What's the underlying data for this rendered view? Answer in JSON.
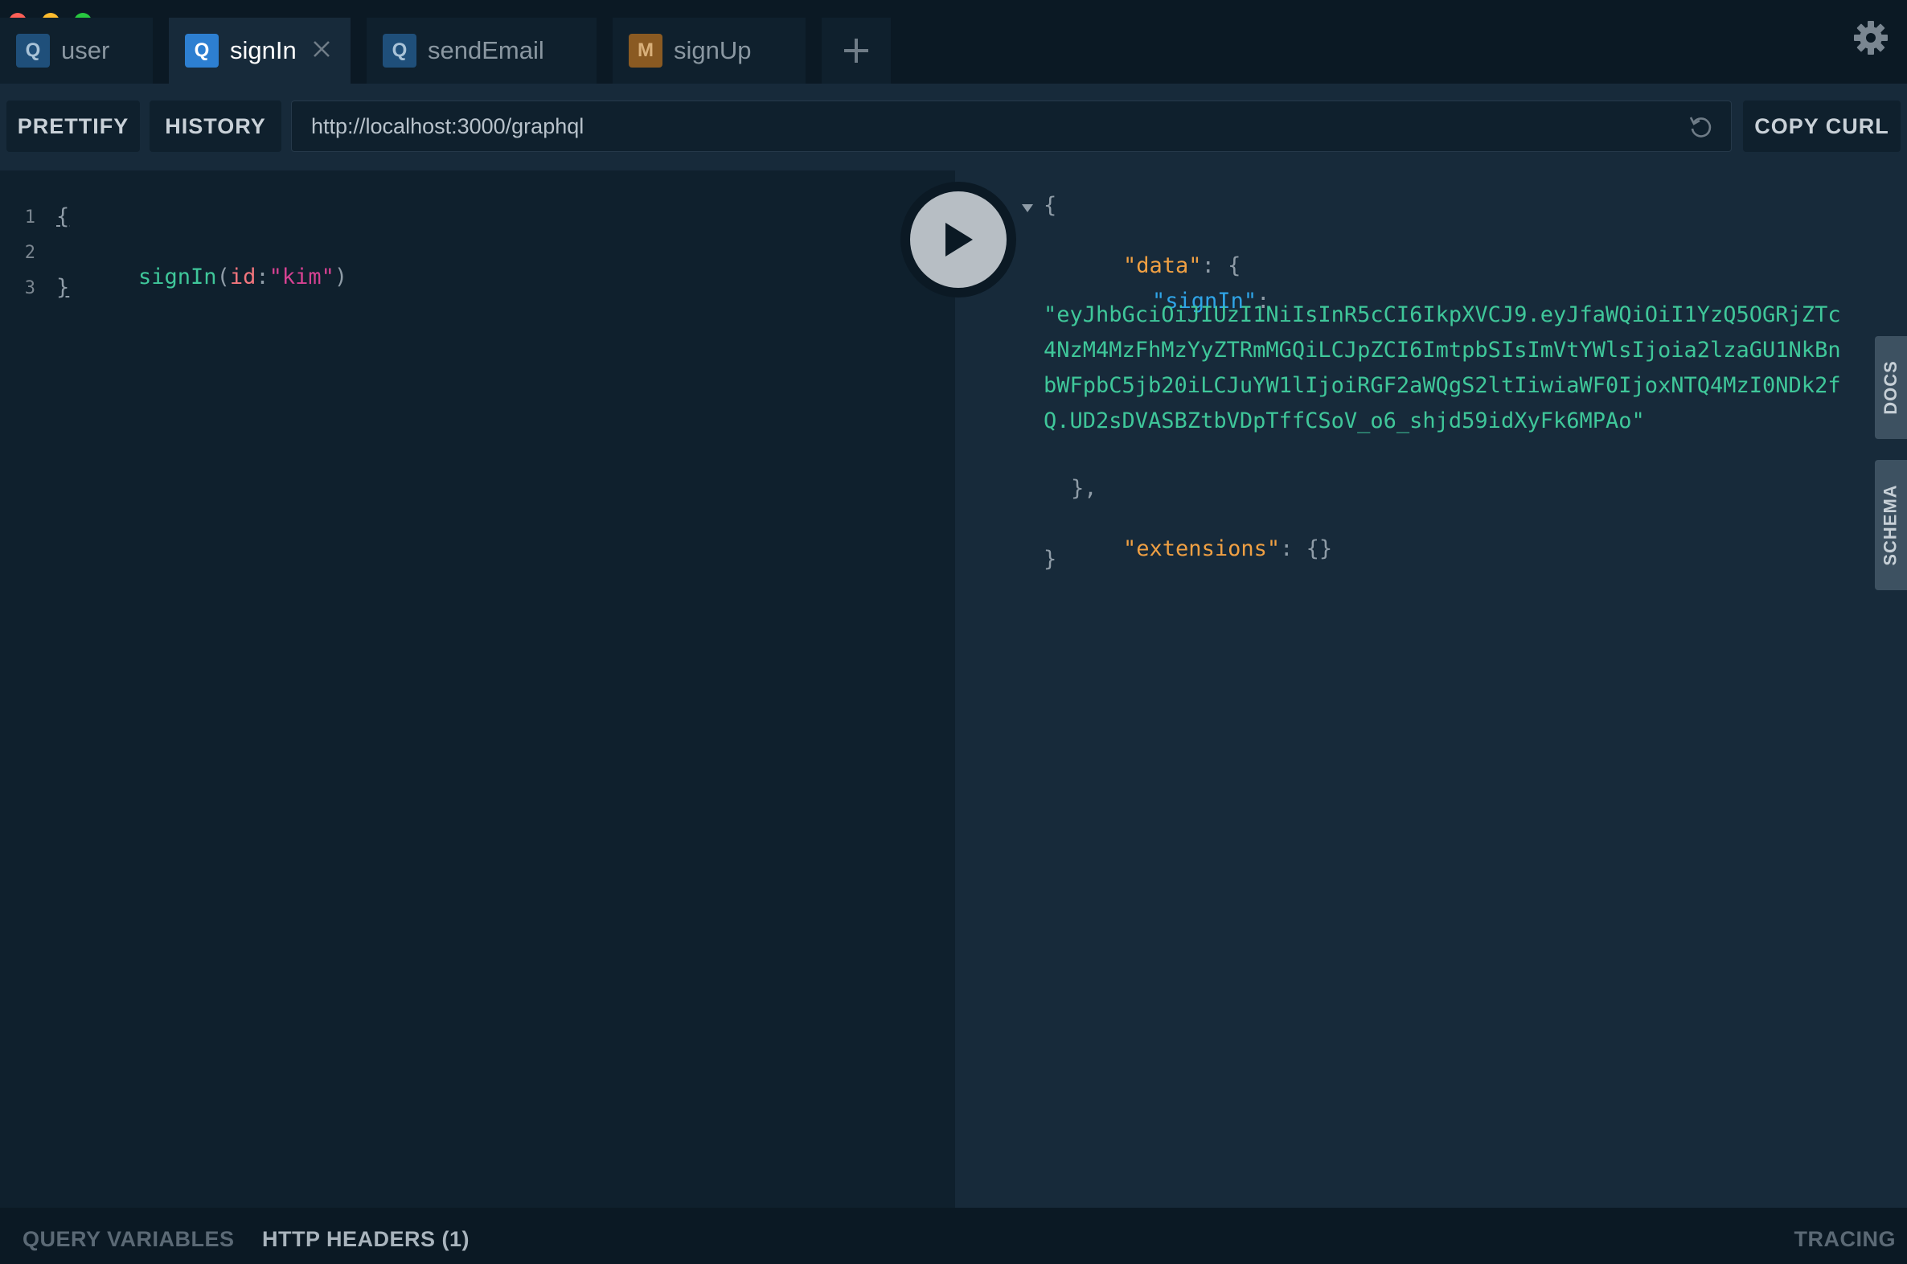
{
  "window": {
    "traffic_lights": [
      "close",
      "minimize",
      "maximize"
    ]
  },
  "tabs": [
    {
      "badge": "Q",
      "label": "user"
    },
    {
      "badge": "Q",
      "label": "signIn",
      "active": true,
      "close_icon": "close-icon"
    },
    {
      "badge": "Q",
      "label": "sendEmail"
    },
    {
      "badge": "M",
      "label": "signUp"
    }
  ],
  "add_tab_icon": "plus-icon",
  "settings_icon": "gear-icon",
  "toolbar": {
    "prettify_label": "PRETTIFY",
    "history_label": "HISTORY",
    "url": "http://localhost:3000/graphql",
    "reload_icon": "reload-icon",
    "copy_curl_label": "COPY CURL"
  },
  "editor": {
    "line_numbers": [
      "1",
      "2",
      "3"
    ],
    "line1": "{",
    "line2": {
      "field": "signIn",
      "open": "(",
      "arg": "id",
      "colon": ":",
      "value": "\"kim\"",
      "close": ")"
    },
    "line3": "}"
  },
  "run_button_icon": "play-icon",
  "result": {
    "open_brace": "{",
    "data_key": "\"data\"",
    "colon_brace": ": {",
    "signin_key": "\"signIn\"",
    "colon": ":",
    "token": "\"eyJhbGciOiJIUzI1NiIsInR5cCI6IkpXVCJ9.eyJfaWQiOiI1YzQ5OGRjZTc4NzM4MzFhMzYyZTRmMGQiLCJpZCI6ImtpbSIsImVtYWlsIjoia2lzaGU1NkBnbWFpbC5jb20iLCJuYW1lIjoiRGF2aWQgS2ltIiwiaWF0IjoxNTQ4MzI0NDk2fQ.UD2sDVASBZtbVDpTffCSoV_o6_shjd59idXyFk6MPAo\"",
    "close_data": "},",
    "extensions_key": "\"extensions\"",
    "extensions_val": ": {}",
    "close_brace": "}"
  },
  "side_tabs": {
    "docs": "DOCS",
    "schema": "SCHEMA"
  },
  "bottom": {
    "query_variables": "QUERY VARIABLES",
    "http_headers": "HTTP HEADERS (1)",
    "tracing": "TRACING"
  }
}
